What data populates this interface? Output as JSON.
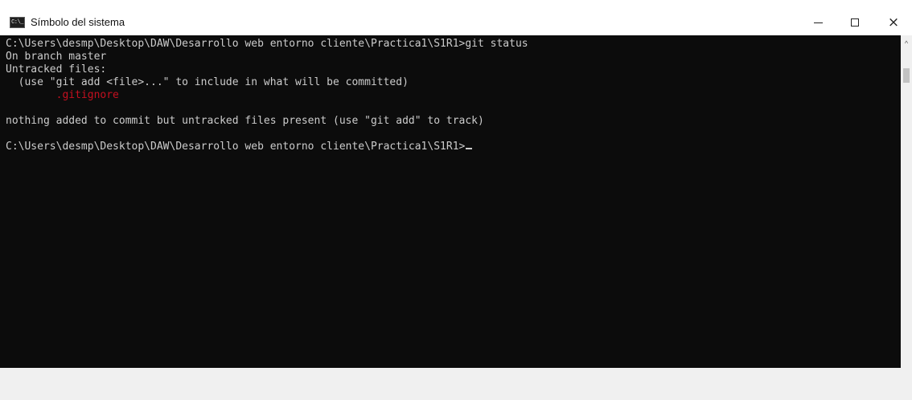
{
  "window": {
    "title": "Símbolo del sistema",
    "icon_text": "C:\\_"
  },
  "controls": {
    "minimize": "minimize",
    "maximize": "maximize",
    "close": "×"
  },
  "console": {
    "lines": [
      "C:\\Users\\desmp\\Desktop\\DAW\\Desarrollo web entorno cliente\\Practica1\\S1R1>git status",
      "On branch master",
      "Untracked files:",
      "  (use \"git add <file>...\" to include in what will be committed)",
      "        .gitignore",
      "",
      "nothing added to commit but untracked files present (use \"git add\" to track)",
      "",
      "C:\\Users\\desmp\\Desktop\\DAW\\Desarrollo web entorno cliente\\Practica1\\S1R1>"
    ],
    "colors": {
      "background": "#0c0c0c",
      "text": "#cccccc",
      "untracked": "#c50f1f"
    }
  },
  "scrollbar": {
    "up_arrow": "^"
  }
}
